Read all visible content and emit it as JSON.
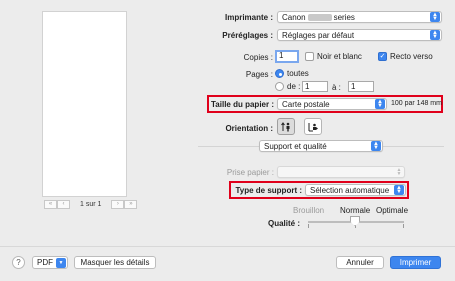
{
  "printer": {
    "label": "Imprimante :",
    "value_prefix": "Canon",
    "value_suffix": "series"
  },
  "presets": {
    "label": "Préréglages :",
    "value": "Réglages par défaut"
  },
  "copies": {
    "label": "Copies :",
    "value": "1",
    "bw_label": "Noir et blanc",
    "duplex_label": "Recto verso",
    "bw_checked": false,
    "duplex_checked": true
  },
  "pages": {
    "label": "Pages :",
    "all_label": "toutes",
    "from_label": "de :",
    "from_value": "1",
    "to_label": "à :",
    "to_value": "1"
  },
  "paper_size": {
    "label": "Taille du papier :",
    "value": "Carte postale",
    "dimensions": "100 par 148 mm"
  },
  "orientation": {
    "label": "Orientation :"
  },
  "panel": {
    "value": "Support et qualité"
  },
  "paper_source": {
    "label": "Prise papier :",
    "value": ""
  },
  "media_type": {
    "label": "Type de support :",
    "value": "Sélection automatique"
  },
  "quality": {
    "label": "Qualité :",
    "low": "Brouillon",
    "mid": "Normale",
    "high": "Optimale"
  },
  "preview": {
    "page_label": "1 sur 1"
  },
  "footer": {
    "help": "?",
    "pdf": "PDF",
    "hide_details": "Masquer les détails",
    "cancel": "Annuler",
    "print": "Imprimer"
  },
  "colors": {
    "accent": "#3d86ef",
    "highlight_box": "#e0001b"
  }
}
